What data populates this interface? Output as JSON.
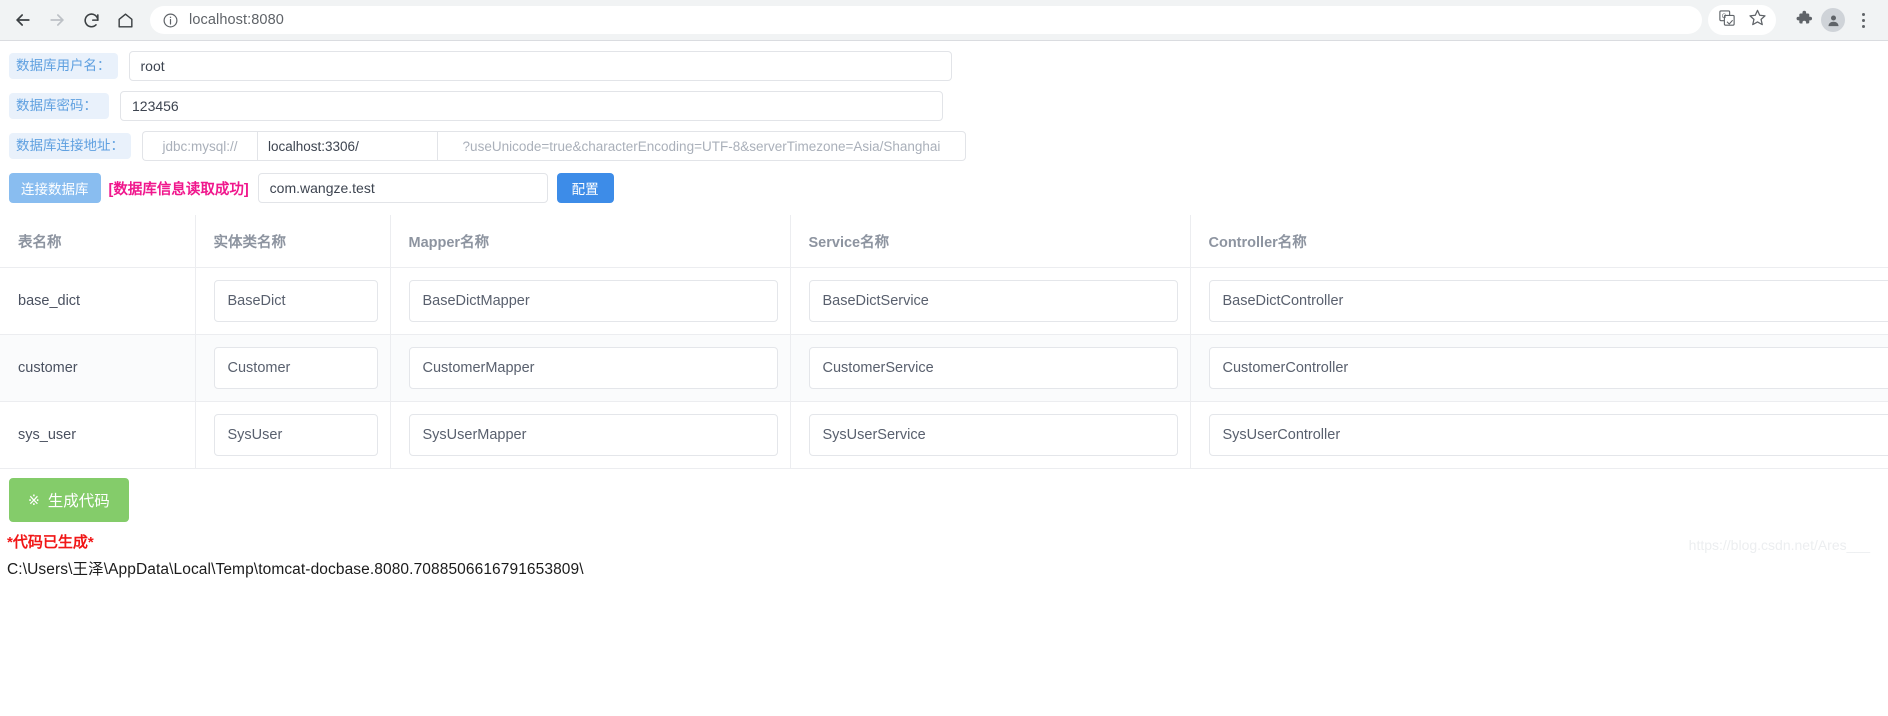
{
  "browser": {
    "back_icon": "arrow-left-icon",
    "forward_icon": "arrow-right-icon",
    "reload_icon": "reload-icon",
    "home_icon": "home-icon",
    "site_info_icon": "info-circle-icon",
    "url_scheme_hidden": "",
    "url_host": "localhost",
    "url_port": ":8080",
    "url_full": "localhost:8080",
    "translate_icon": "translate-icon",
    "bookmark_icon": "star-icon",
    "extensions_icon": "puzzle-piece-icon",
    "profile_icon": "user-avatar-icon",
    "menu_icon": "three-dots-menu-icon"
  },
  "form": {
    "username_label": "数据库用户名：",
    "username_value": "root",
    "password_label": "数据库密码：",
    "password_value": "123456",
    "url_label": "数据库连接地址：",
    "url_prefix": "jdbc:mysql://",
    "url_host": "localhost:3306/",
    "url_params": "?useUnicode=true&characterEncoding=UTF-8&serverTimezone=Asia/Shanghai"
  },
  "actions": {
    "connect_label": "连接数据库",
    "status_message": "[数据库信息读取成功]",
    "package_value": "com.wangze.test",
    "config_label": "配置"
  },
  "table": {
    "headers": [
      "表名称",
      "实体类名称",
      "Mapper名称",
      "Service名称",
      "Controller名称"
    ],
    "rows": [
      {
        "table_name": "base_dict",
        "entity": "BaseDict",
        "mapper": "BaseDictMapper",
        "service": "BaseDictService",
        "controller": "BaseDictController"
      },
      {
        "table_name": "customer",
        "entity": "Customer",
        "mapper": "CustomerMapper",
        "service": "CustomerService",
        "controller": "CustomerController"
      },
      {
        "table_name": "sys_user",
        "entity": "SysUser",
        "mapper": "SysUserMapper",
        "service": "SysUserService",
        "controller": "SysUserController"
      }
    ]
  },
  "footer": {
    "generate_icon": "※",
    "generate_label": "生成代码",
    "result_title": "*代码已生成*",
    "result_path": "C:\\Users\\王泽\\AppData\\Local\\Temp\\tomcat-docbase.8080.7088506616791653809\\",
    "watermark": "https://blog.csdn.net/Ares___"
  },
  "colors": {
    "label_bg": "#e9f1fb",
    "label_text": "#5fa0e0",
    "connect_btn": "#89bdf0",
    "config_btn": "#3d8ce8",
    "status_pink": "#f0178d",
    "generate_btn": "#84cc6a",
    "result_red": "#f11616"
  }
}
